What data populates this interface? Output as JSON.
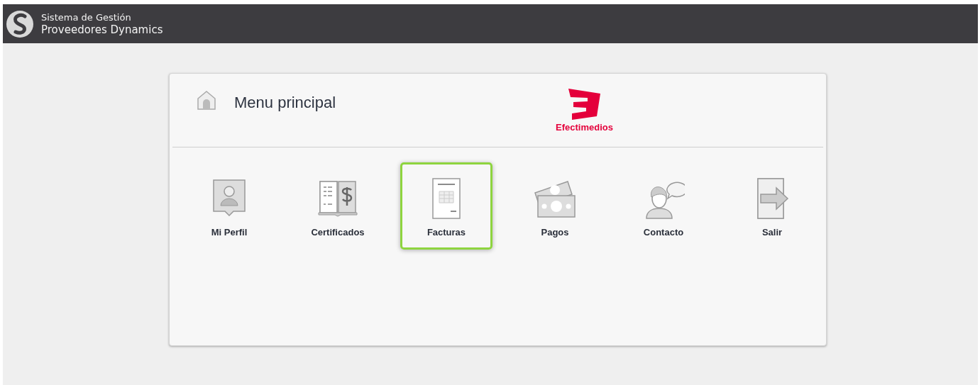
{
  "header": {
    "line1": "Sistema de Gestión",
    "line2": "Proveedores Dynamics"
  },
  "card": {
    "title": "Menu principal",
    "brand": "Efectimedios"
  },
  "menu_items": [
    {
      "label": "Mi Perfil",
      "kind": "profile",
      "selected": false
    },
    {
      "label": "Certificados",
      "kind": "certificates",
      "selected": false
    },
    {
      "label": "Facturas",
      "kind": "invoices",
      "selected": true
    },
    {
      "label": "Pagos",
      "kind": "payments",
      "selected": false
    },
    {
      "label": "Contacto",
      "kind": "contact",
      "selected": false
    },
    {
      "label": "Salir",
      "kind": "exit",
      "selected": false
    }
  ]
}
